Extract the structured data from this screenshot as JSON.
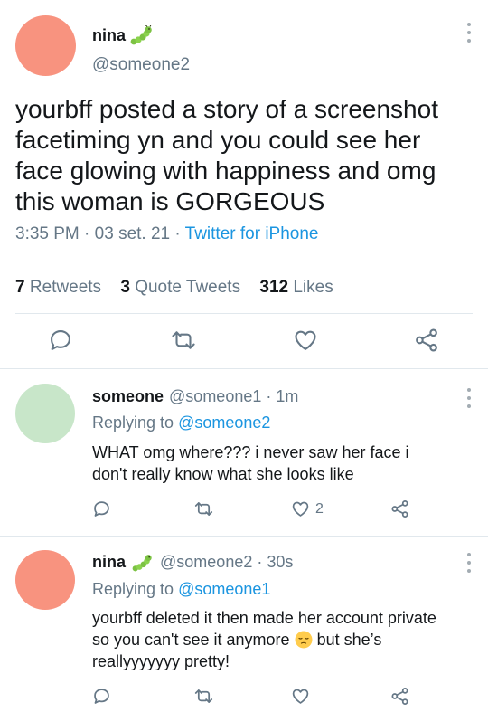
{
  "main_tweet": {
    "author_name": "nina",
    "name_emoji": "caterpillar-icon",
    "handle": "@someone2",
    "text": "yourbff posted a story of a screenshot facetiming yn and you could see her face glowing with happiness and omg this woman is GORGEOUS",
    "time": "3:35 PM",
    "date": "03 set. 21",
    "source": "Twitter for iPhone",
    "retweets_count": "7",
    "retweets_label": "Retweets",
    "quotes_count": "3",
    "quotes_label": "Quote Tweets",
    "likes_count": "312",
    "likes_label": "Likes"
  },
  "replies": [
    {
      "author_name": "someone",
      "handle": "@someone1",
      "age": "1m",
      "replying_prefix": "Replying to",
      "replying_to": "@someone2",
      "text": "WHAT omg where??? i never saw her face i don't really know what she looks like",
      "like_count": "2",
      "avatar_color": "#c8e6c9"
    },
    {
      "author_name": "nina",
      "name_emoji": "caterpillar-icon",
      "handle": "@someone2",
      "age": "30s",
      "replying_prefix": "Replying to",
      "replying_to": "@someone1",
      "text_before": "yourbff deleted it then made her account private so you can't see it anymore",
      "text_emoji": "pensive-face-icon",
      "text_after": "but she’s reallyyyyyyy pretty!",
      "avatar_color": "#f8937f"
    }
  ],
  "colors": {
    "accent": "#1b95e0",
    "secondary_text": "#657786",
    "icon": "#657786",
    "divider": "#e1e8ed"
  }
}
